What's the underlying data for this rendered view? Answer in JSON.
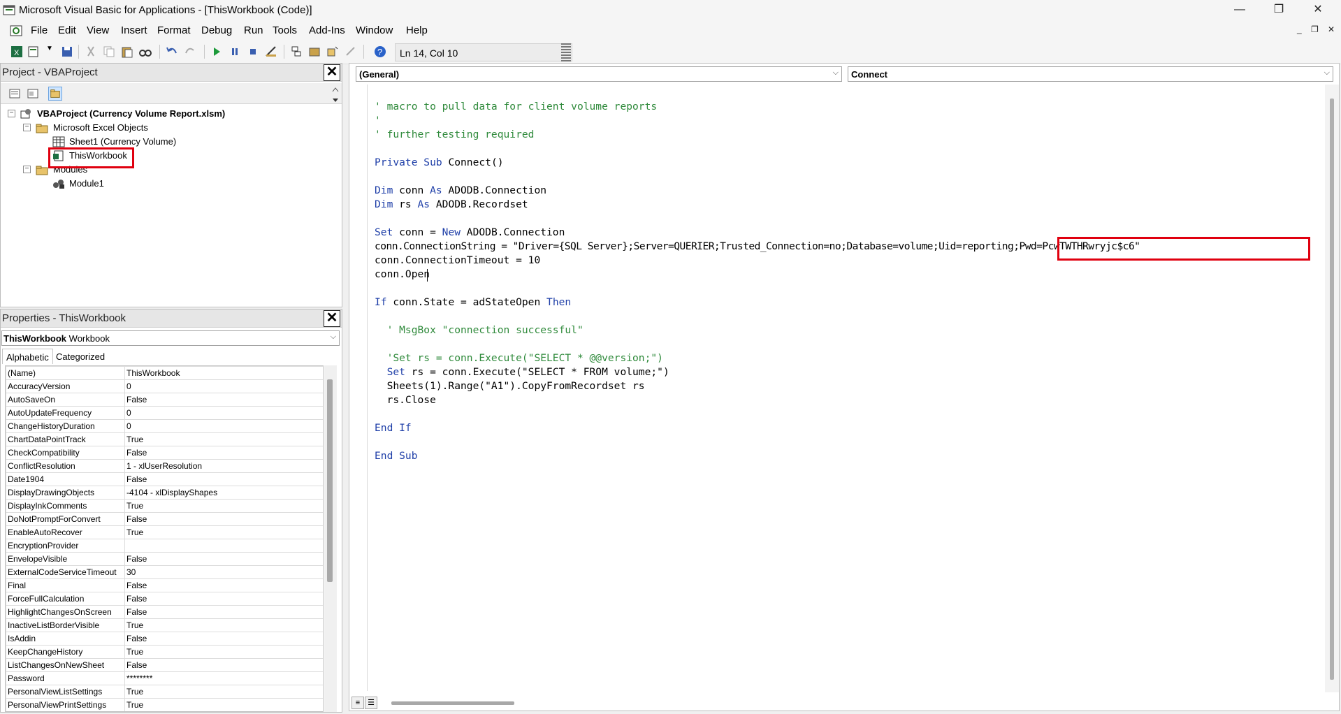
{
  "window": {
    "title": "Microsoft Visual Basic for Applications - [ThisWorkbook (Code)]",
    "minimize": "—",
    "restore": "❐",
    "close": "✕"
  },
  "menu": {
    "items": [
      "File",
      "Edit",
      "View",
      "Insert",
      "Format",
      "Debug",
      "Run",
      "Tools",
      "Add-Ins",
      "Window",
      "Help"
    ],
    "mdi_min": "_",
    "mdi_restore": "❐",
    "mdi_close": "✕"
  },
  "toolbar": {
    "position": "Ln 14, Col 10"
  },
  "project": {
    "title": "Project - VBAProject",
    "close": "✕",
    "root": "VBAProject (Currency Volume Report.xlsm)",
    "folder_objects": "Microsoft Excel Objects",
    "sheet1": "Sheet1 (Currency Volume)",
    "thisworkbook": "ThisWorkbook",
    "folder_modules": "Modules",
    "module1": "Module1",
    "twisty_minus": "−"
  },
  "properties": {
    "title": "Properties - ThisWorkbook",
    "close": "✕",
    "object_name": "ThisWorkbook",
    "object_type": "Workbook",
    "tab_alpha": "Alphabetic",
    "tab_cat": "Categorized",
    "rows": [
      {
        "name": "(Name)",
        "value": "ThisWorkbook"
      },
      {
        "name": "AccuracyVersion",
        "value": "0"
      },
      {
        "name": "AutoSaveOn",
        "value": "False"
      },
      {
        "name": "AutoUpdateFrequency",
        "value": "0"
      },
      {
        "name": "ChangeHistoryDuration",
        "value": "0"
      },
      {
        "name": "ChartDataPointTrack",
        "value": "True"
      },
      {
        "name": "CheckCompatibility",
        "value": "False"
      },
      {
        "name": "ConflictResolution",
        "value": "1 - xlUserResolution"
      },
      {
        "name": "Date1904",
        "value": "False"
      },
      {
        "name": "DisplayDrawingObjects",
        "value": "-4104 - xlDisplayShapes"
      },
      {
        "name": "DisplayInkComments",
        "value": "True"
      },
      {
        "name": "DoNotPromptForConvert",
        "value": "False"
      },
      {
        "name": "EnableAutoRecover",
        "value": "True"
      },
      {
        "name": "EncryptionProvider",
        "value": ""
      },
      {
        "name": "EnvelopeVisible",
        "value": "False"
      },
      {
        "name": "ExternalCodeServiceTimeout",
        "value": "30"
      },
      {
        "name": "Final",
        "value": "False"
      },
      {
        "name": "ForceFullCalculation",
        "value": "False"
      },
      {
        "name": "HighlightChangesOnScreen",
        "value": "False"
      },
      {
        "name": "InactiveListBorderVisible",
        "value": "True"
      },
      {
        "name": "IsAddin",
        "value": "False"
      },
      {
        "name": "KeepChangeHistory",
        "value": "True"
      },
      {
        "name": "ListChangesOnNewSheet",
        "value": "False"
      },
      {
        "name": "Password",
        "value": "********"
      },
      {
        "name": "PersonalViewListSettings",
        "value": "True"
      },
      {
        "name": "PersonalViewPrintSettings",
        "value": "True"
      }
    ]
  },
  "code": {
    "object_combo": "(General)",
    "proc_combo": "Connect",
    "l1": "' macro to pull data for client volume reports",
    "l2": "'",
    "l3": "' further testing required",
    "l5a": "Private Sub",
    "l5b": " Connect()",
    "l7a": "Dim",
    "l7b": " conn ",
    "l7c": "As",
    "l7d": " ADODB.Connection",
    "l8a": "Dim",
    "l8b": " rs ",
    "l8c": "As",
    "l8d": " ADODB.Recordset",
    "l10a": "Set",
    "l10b": " conn = ",
    "l10c": "New",
    "l10d": " ADODB.Connection",
    "l11": "conn.ConnectionString = \"Driver={SQL Server};Server=QUERIER;Trusted_Connection=no;Database=volume;Uid=reporting;Pwd=PcwTWTHRwryjc$c6\"",
    "l12": "conn.ConnectionTimeout = 10",
    "l13": "conn.Open",
    "l15a": "If",
    "l15b": " conn.State = adStateOpen ",
    "l15c": "Then",
    "l17": "  ' MsgBox \"connection successful\"",
    "l19": "  'Set rs = conn.Execute(\"SELECT * @@version;\")",
    "l20a": "  Set",
    "l20b": " rs = conn.Execute(\"SELECT * FROM volume;\")",
    "l21": "  Sheets(1).Range(\"A1\").CopyFromRecordset rs",
    "l22": "  rs.Close",
    "l24": "End If",
    "l26": "End Sub"
  },
  "colors": {
    "comment": "#2f8a3b",
    "keyword": "#1f3fa8",
    "highlight": "#e0000f"
  }
}
